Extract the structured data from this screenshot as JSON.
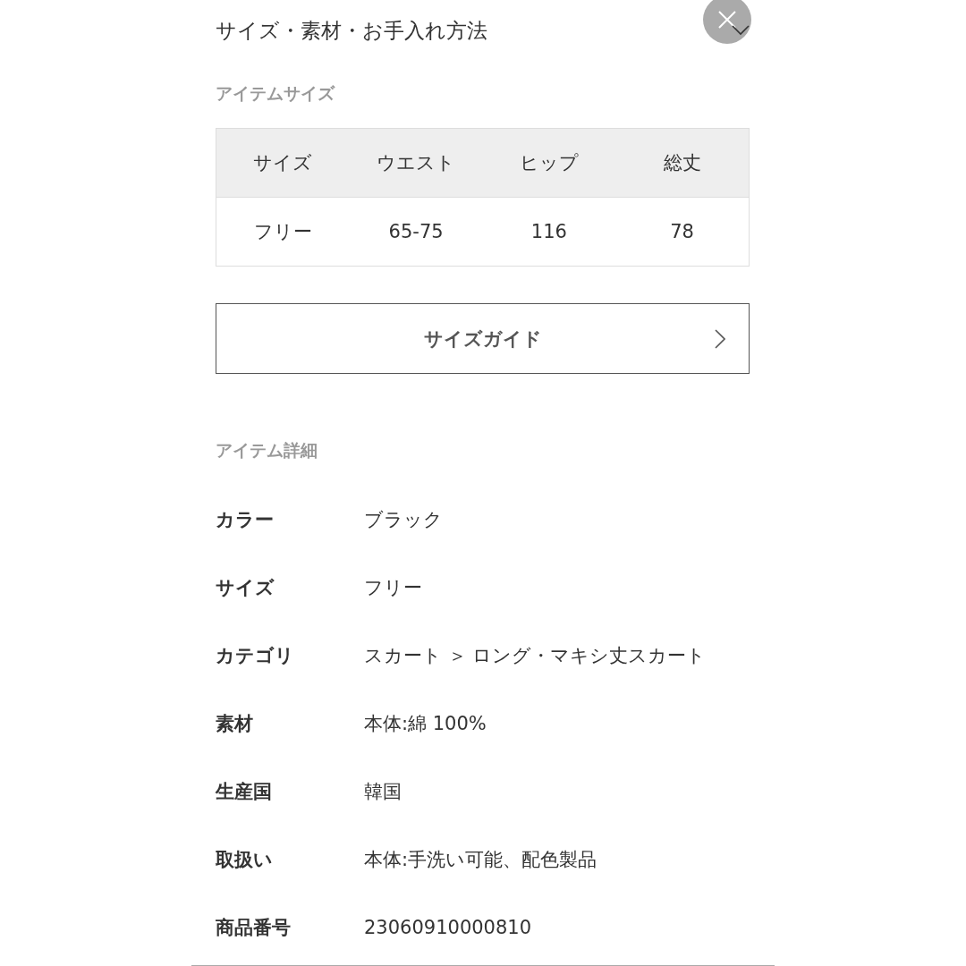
{
  "section": {
    "title": "サイズ・素材・お手入れ方法"
  },
  "size_table": {
    "title": "アイテムサイズ",
    "columns": [
      "サイズ",
      "ウエスト",
      "ヒップ",
      "総丈"
    ],
    "rows": [
      [
        "フリー",
        "65-75",
        "116",
        "78"
      ]
    ]
  },
  "size_guide_button": {
    "label": "サイズガイド"
  },
  "details": {
    "title": "アイテム詳細",
    "rows": [
      {
        "label": "カラー",
        "value": "ブラック"
      },
      {
        "label": "サイズ",
        "value": "フリー"
      },
      {
        "label": "カテゴリ",
        "value": "スカート ＞ ロング・マキシ丈スカート"
      },
      {
        "label": "素材",
        "value": "本体:綿 100%"
      },
      {
        "label": "生産国",
        "value": "韓国"
      },
      {
        "label": "取扱い",
        "value": "本体:手洗い可能、配色製品"
      },
      {
        "label": "商品番号",
        "value": "23060910000810"
      }
    ]
  }
}
